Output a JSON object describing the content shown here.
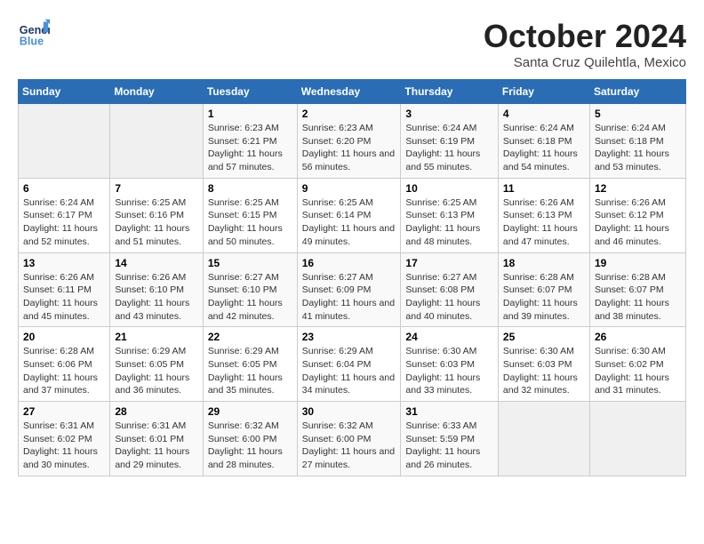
{
  "header": {
    "logo_line1": "General",
    "logo_line2": "Blue",
    "month": "October 2024",
    "location": "Santa Cruz Quilehtla, Mexico"
  },
  "weekdays": [
    "Sunday",
    "Monday",
    "Tuesday",
    "Wednesday",
    "Thursday",
    "Friday",
    "Saturday"
  ],
  "weeks": [
    [
      {
        "day": "",
        "info": ""
      },
      {
        "day": "",
        "info": ""
      },
      {
        "day": "1",
        "info": "Sunrise: 6:23 AM\nSunset: 6:21 PM\nDaylight: 11 hours and 57 minutes."
      },
      {
        "day": "2",
        "info": "Sunrise: 6:23 AM\nSunset: 6:20 PM\nDaylight: 11 hours and 56 minutes."
      },
      {
        "day": "3",
        "info": "Sunrise: 6:24 AM\nSunset: 6:19 PM\nDaylight: 11 hours and 55 minutes."
      },
      {
        "day": "4",
        "info": "Sunrise: 6:24 AM\nSunset: 6:18 PM\nDaylight: 11 hours and 54 minutes."
      },
      {
        "day": "5",
        "info": "Sunrise: 6:24 AM\nSunset: 6:18 PM\nDaylight: 11 hours and 53 minutes."
      }
    ],
    [
      {
        "day": "6",
        "info": "Sunrise: 6:24 AM\nSunset: 6:17 PM\nDaylight: 11 hours and 52 minutes."
      },
      {
        "day": "7",
        "info": "Sunrise: 6:25 AM\nSunset: 6:16 PM\nDaylight: 11 hours and 51 minutes."
      },
      {
        "day": "8",
        "info": "Sunrise: 6:25 AM\nSunset: 6:15 PM\nDaylight: 11 hours and 50 minutes."
      },
      {
        "day": "9",
        "info": "Sunrise: 6:25 AM\nSunset: 6:14 PM\nDaylight: 11 hours and 49 minutes."
      },
      {
        "day": "10",
        "info": "Sunrise: 6:25 AM\nSunset: 6:13 PM\nDaylight: 11 hours and 48 minutes."
      },
      {
        "day": "11",
        "info": "Sunrise: 6:26 AM\nSunset: 6:13 PM\nDaylight: 11 hours and 47 minutes."
      },
      {
        "day": "12",
        "info": "Sunrise: 6:26 AM\nSunset: 6:12 PM\nDaylight: 11 hours and 46 minutes."
      }
    ],
    [
      {
        "day": "13",
        "info": "Sunrise: 6:26 AM\nSunset: 6:11 PM\nDaylight: 11 hours and 45 minutes."
      },
      {
        "day": "14",
        "info": "Sunrise: 6:26 AM\nSunset: 6:10 PM\nDaylight: 11 hours and 43 minutes."
      },
      {
        "day": "15",
        "info": "Sunrise: 6:27 AM\nSunset: 6:10 PM\nDaylight: 11 hours and 42 minutes."
      },
      {
        "day": "16",
        "info": "Sunrise: 6:27 AM\nSunset: 6:09 PM\nDaylight: 11 hours and 41 minutes."
      },
      {
        "day": "17",
        "info": "Sunrise: 6:27 AM\nSunset: 6:08 PM\nDaylight: 11 hours and 40 minutes."
      },
      {
        "day": "18",
        "info": "Sunrise: 6:28 AM\nSunset: 6:07 PM\nDaylight: 11 hours and 39 minutes."
      },
      {
        "day": "19",
        "info": "Sunrise: 6:28 AM\nSunset: 6:07 PM\nDaylight: 11 hours and 38 minutes."
      }
    ],
    [
      {
        "day": "20",
        "info": "Sunrise: 6:28 AM\nSunset: 6:06 PM\nDaylight: 11 hours and 37 minutes."
      },
      {
        "day": "21",
        "info": "Sunrise: 6:29 AM\nSunset: 6:05 PM\nDaylight: 11 hours and 36 minutes."
      },
      {
        "day": "22",
        "info": "Sunrise: 6:29 AM\nSunset: 6:05 PM\nDaylight: 11 hours and 35 minutes."
      },
      {
        "day": "23",
        "info": "Sunrise: 6:29 AM\nSunset: 6:04 PM\nDaylight: 11 hours and 34 minutes."
      },
      {
        "day": "24",
        "info": "Sunrise: 6:30 AM\nSunset: 6:03 PM\nDaylight: 11 hours and 33 minutes."
      },
      {
        "day": "25",
        "info": "Sunrise: 6:30 AM\nSunset: 6:03 PM\nDaylight: 11 hours and 32 minutes."
      },
      {
        "day": "26",
        "info": "Sunrise: 6:30 AM\nSunset: 6:02 PM\nDaylight: 11 hours and 31 minutes."
      }
    ],
    [
      {
        "day": "27",
        "info": "Sunrise: 6:31 AM\nSunset: 6:02 PM\nDaylight: 11 hours and 30 minutes."
      },
      {
        "day": "28",
        "info": "Sunrise: 6:31 AM\nSunset: 6:01 PM\nDaylight: 11 hours and 29 minutes."
      },
      {
        "day": "29",
        "info": "Sunrise: 6:32 AM\nSunset: 6:00 PM\nDaylight: 11 hours and 28 minutes."
      },
      {
        "day": "30",
        "info": "Sunrise: 6:32 AM\nSunset: 6:00 PM\nDaylight: 11 hours and 27 minutes."
      },
      {
        "day": "31",
        "info": "Sunrise: 6:33 AM\nSunset: 5:59 PM\nDaylight: 11 hours and 26 minutes."
      },
      {
        "day": "",
        "info": ""
      },
      {
        "day": "",
        "info": ""
      }
    ]
  ]
}
